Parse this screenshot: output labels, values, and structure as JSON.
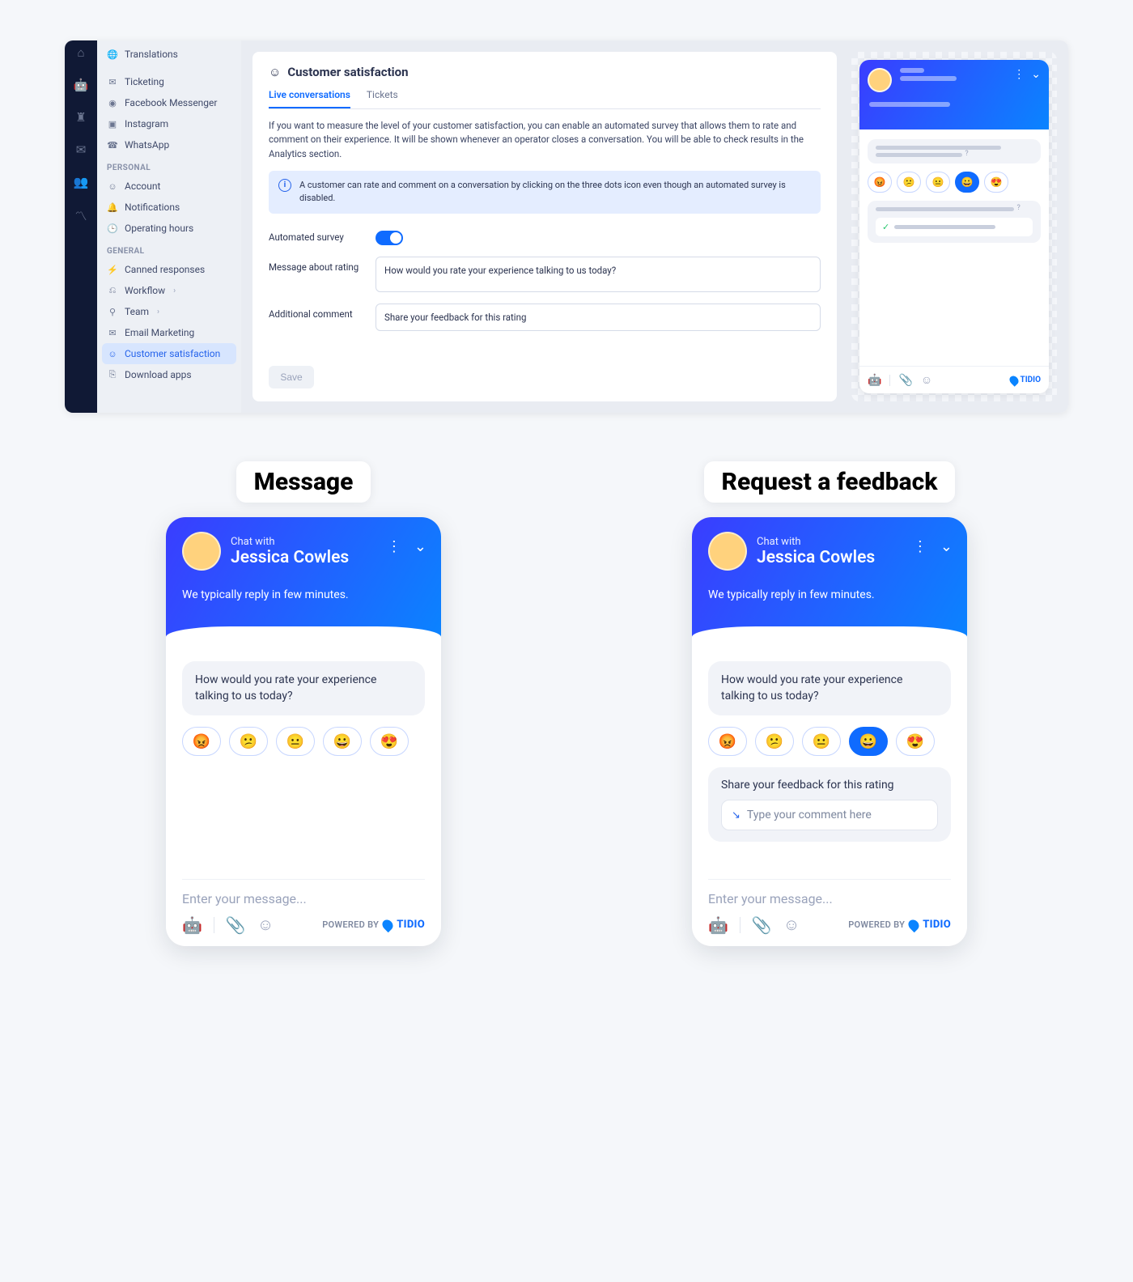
{
  "rail_icons": [
    "home",
    "bot",
    "org",
    "inbox",
    "people",
    "analytics"
  ],
  "sidebar": {
    "top": [
      {
        "icon": "🌐",
        "label": "Translations"
      }
    ],
    "channels": [
      {
        "icon": "✉",
        "label": "Ticketing"
      },
      {
        "icon": "◉",
        "label": "Facebook Messenger"
      },
      {
        "icon": "▣",
        "label": "Instagram"
      },
      {
        "icon": "☎",
        "label": "WhatsApp"
      }
    ],
    "personal_head": "PERSONAL",
    "personal": [
      {
        "icon": "☺",
        "label": "Account"
      },
      {
        "icon": "🔔",
        "label": "Notifications"
      },
      {
        "icon": "🕒",
        "label": "Operating hours"
      }
    ],
    "general_head": "GENERAL",
    "general": [
      {
        "icon": "⚡",
        "label": "Canned responses"
      },
      {
        "icon": "⎌",
        "label": "Workflow",
        "chev": true
      },
      {
        "icon": "⚲",
        "label": "Team",
        "chev": true
      },
      {
        "icon": "✉",
        "label": "Email Marketing"
      },
      {
        "icon": "☺",
        "label": "Customer satisfaction",
        "active": true
      },
      {
        "icon": "⎘",
        "label": "Download apps"
      }
    ]
  },
  "panel": {
    "title": "Customer satisfaction",
    "tab1": "Live conversations",
    "tab2": "Tickets",
    "desc": "If you want to measure the level of your customer satisfaction, you can enable an automated survey that allows them to rate and comment on their experience. It will be shown whenever an operator closes a conversation. You will be able to check results in the Analytics section.",
    "info": "A customer can rate and comment on a conversation by clicking on the three dots icon even though an automated survey is disabled.",
    "auto_label": "Automated survey",
    "msg_label": "Message about rating",
    "msg_val": "How would you rate your experience talking to us today?",
    "comment_label": "Additional comment",
    "comment_val": "Share your feedback for this rating",
    "save": "Save"
  },
  "tidio_brand": "TIDIO",
  "widget": {
    "label_message": "Message",
    "label_feedback": "Request a feedback",
    "chat_with": "Chat with",
    "operator": "Jessica Cowles",
    "reply_time": "We typically reply in few minutes.",
    "rate_q": "How would you rate your experience talking to us today?",
    "fb_title": "Share your feedback for this rating",
    "fb_ph": "Type your comment here",
    "entry_ph": "Enter your message...",
    "powered": "POWERED BY",
    "emojis": [
      "😡",
      "😕",
      "😐",
      "😀",
      "😍"
    ]
  }
}
